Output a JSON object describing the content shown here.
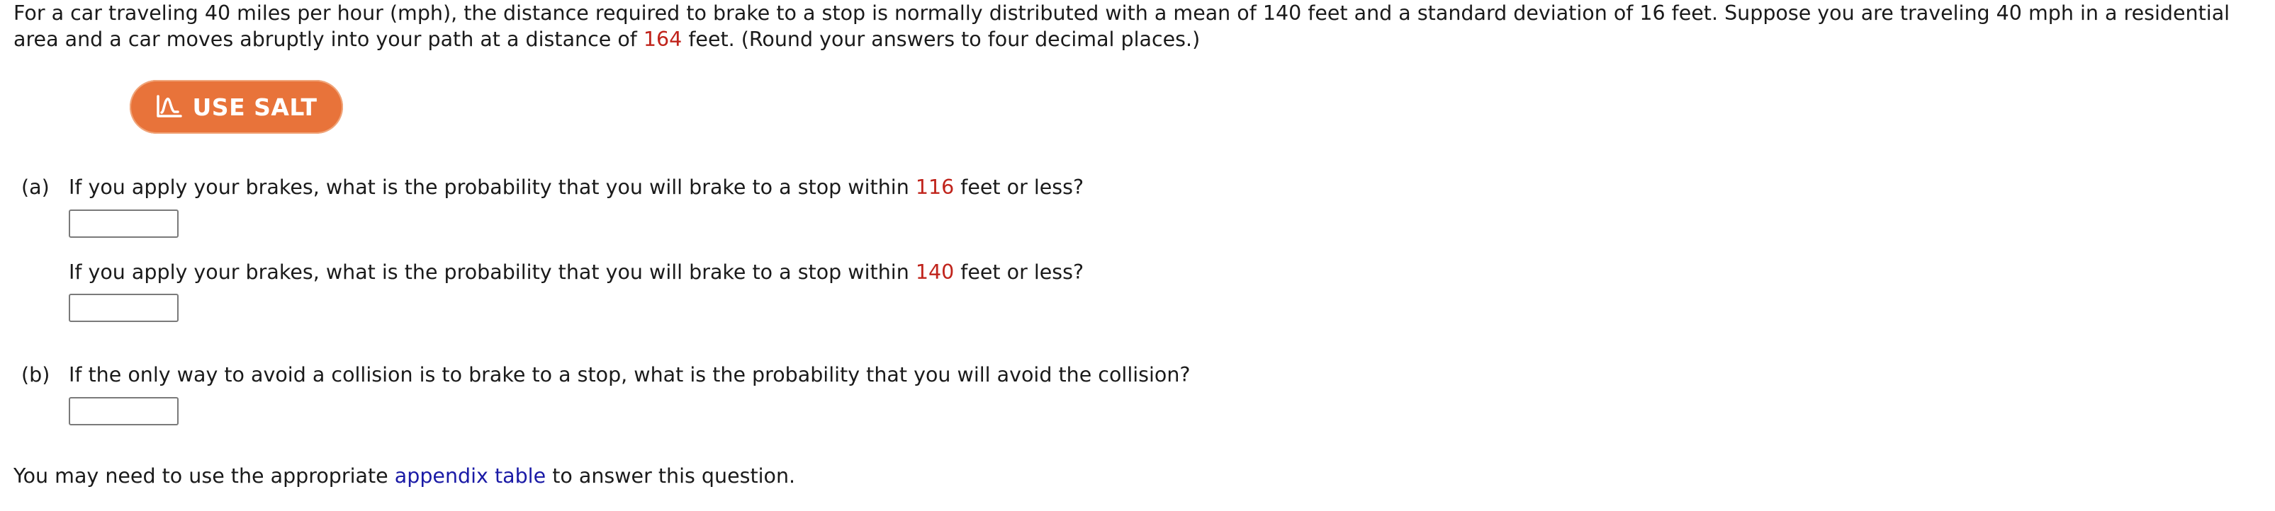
{
  "intro": {
    "part1": "For a car traveling 40 miles per hour (mph), the distance required to brake to a stop is normally distributed with a mean of 140 feet and a standard deviation of 16 feet. Suppose you are traveling 40 mph in a residential area and a car moves abruptly into your path at a distance of ",
    "distance": "164",
    "part2": " feet. (Round your answers to four decimal places.)"
  },
  "salt_button": {
    "label": "USE SALT",
    "color": "#e8733a"
  },
  "part_a": {
    "letter": "(a)",
    "q1": {
      "before": "If you apply your brakes, what is the probability that you will brake to a stop within ",
      "value": "116",
      "after": " feet or less?",
      "answer": ""
    },
    "q2": {
      "before": "If you apply your brakes, what is the probability that you will brake to a stop within ",
      "value": "140",
      "after": " feet or less?",
      "answer": ""
    }
  },
  "part_b": {
    "letter": "(b)",
    "question": "If the only way to avoid a collision is to brake to a stop, what is the probability that you will avoid the collision?",
    "answer": ""
  },
  "footer": {
    "before": "You may need to use the appropriate ",
    "link": "appendix table",
    "after": " to answer this question."
  },
  "colors": {
    "highlight": "#c0241c",
    "link": "#1a1aa6"
  }
}
